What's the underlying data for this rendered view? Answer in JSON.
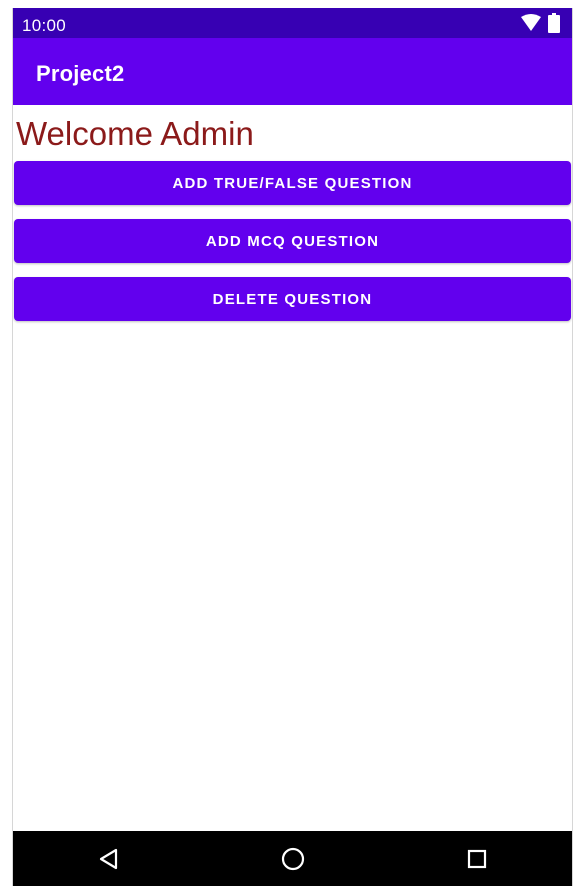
{
  "status_bar": {
    "time": "10:00",
    "icons": [
      "wifi-icon",
      "battery-icon"
    ]
  },
  "app_bar": {
    "title": "Project2"
  },
  "main": {
    "welcome_text": "Welcome Admin",
    "buttons": [
      {
        "label": "ADD TRUE/FALSE QUESTION"
      },
      {
        "label": "ADD MCQ QUESTION"
      },
      {
        "label": "DELETE QUESTION"
      }
    ]
  },
  "nav_bar": {
    "icons": [
      "back-icon",
      "home-icon",
      "recents-icon"
    ]
  },
  "colors": {
    "status_bar": "#3700b3",
    "primary": "#6200ee",
    "welcome_text": "#8b1a1a",
    "nav_bar": "#000000"
  }
}
